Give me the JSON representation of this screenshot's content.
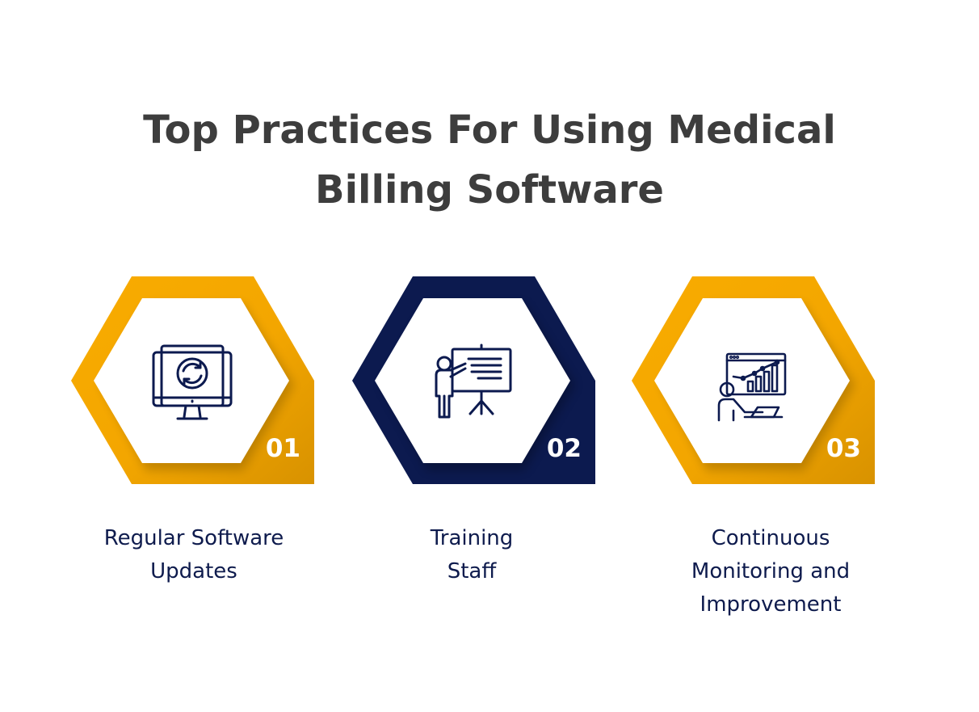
{
  "title": {
    "line1": "Top Practices For Using Medical",
    "line2": "Billing Software"
  },
  "colors": {
    "gold": "#F9AC00",
    "navy": "#0C1A4F",
    "title": "#3D3D3D",
    "label": "#0E1B4D"
  },
  "items": [
    {
      "number": "01",
      "label_lines": [
        "Regular Software",
        "Updates"
      ],
      "icon": "monitor-refresh-icon",
      "color": "gold"
    },
    {
      "number": "02",
      "label_lines": [
        "Training",
        "Staff"
      ],
      "icon": "presenter-board-icon",
      "color": "navy"
    },
    {
      "number": "03",
      "label_lines": [
        "Continuous",
        "Monitoring and",
        "Improvement"
      ],
      "icon": "analyst-chart-icon",
      "color": "gold"
    }
  ]
}
